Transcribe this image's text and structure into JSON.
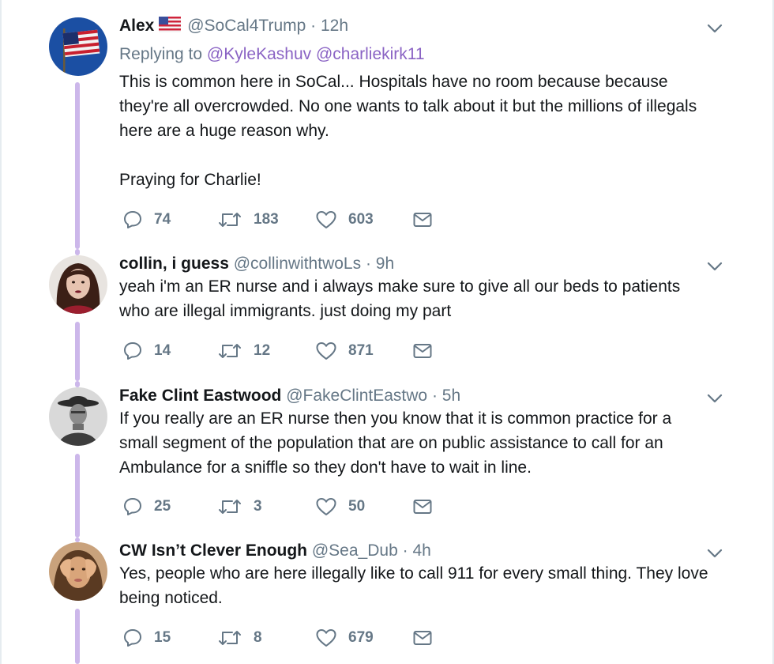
{
  "tweets": [
    {
      "name": "Alex",
      "has_flag": true,
      "handle": "@SoCal4Trump",
      "separator": "·",
      "time": "12h",
      "replying_prefix": "Replying to",
      "replying_mentions": "@KyleKashuv @charliekirk11",
      "text": "This is common here in SoCal... Hospitals have no room because because\nthey're all overcrowded. No one wants to talk about it but the millions of illegals\nhere are a huge reason why.\n\nPraying for Charlie!",
      "replies": "74",
      "retweets": "183",
      "likes": "603"
    },
    {
      "name": "collin, i guess",
      "handle": "@collinwithtwoLs",
      "separator": "·",
      "time": "9h",
      "text": "yeah i'm an ER nurse and i always make sure to give all our beds to patients\nwho are illegal immigrants. just doing my part",
      "replies": "14",
      "retweets": "12",
      "likes": "871"
    },
    {
      "name": "Fake Clint Eastwood",
      "handle": "@FakeClintEastwo",
      "separator": "·",
      "time": "5h",
      "text": "If you really are an ER nurse then you know that it is common practice for a\nsmall segment of the population that are on public assistance to call for an\nAmbulance for a sniffle so they don't have to wait in line.",
      "replies": "25",
      "retweets": "3",
      "likes": "50"
    },
    {
      "name": "CW Isn’t Clever Enough",
      "handle": "@Sea_Dub",
      "separator": "·",
      "time": "4h",
      "text": "Yes, people who are here illegally like to call 911 for every small thing. They love\nbeing noticed.",
      "replies": "15",
      "retweets": "8",
      "likes": "679"
    }
  ],
  "icons": {
    "reply": "reply-icon",
    "retweet": "retweet-icon",
    "like": "heart-icon",
    "message": "envelope-icon",
    "more": "chevron-down-icon"
  },
  "colors": {
    "thread_line": "#ccb7ea",
    "mention": "#8a63c4",
    "secondary_text": "#657786",
    "icon_gray": "#657786"
  }
}
